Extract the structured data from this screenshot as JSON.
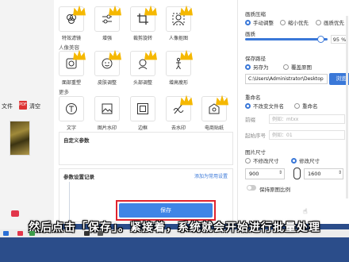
{
  "desktop": {
    "file_label": "文件",
    "clear_label": "清空",
    "pdf_text": "PDF"
  },
  "tools_row1": [
    {
      "label": "特效滤镜",
      "icon": "effects-icon"
    },
    {
      "label": "增强",
      "icon": "enhance-icon"
    },
    {
      "label": "裁剪旋转",
      "icon": "crop-icon"
    },
    {
      "label": "人像抠图",
      "icon": "portrait-cutout-icon"
    }
  ],
  "portrait_section": "人像美容",
  "tools_row2": [
    {
      "label": "面部重塑",
      "icon": "face-reshape-icon"
    },
    {
      "label": "皮肤调整",
      "icon": "skin-adjust-icon"
    },
    {
      "label": "头部调整",
      "icon": "head-adjust-icon"
    },
    {
      "label": "增高瘦形",
      "icon": "body-slim-icon"
    }
  ],
  "more_section": "更多",
  "tools_row3": [
    {
      "label": "文字",
      "icon": "text-icon"
    },
    {
      "label": "图片水印",
      "icon": "image-watermark-icon"
    },
    {
      "label": "边框",
      "icon": "border-icon"
    },
    {
      "label": "去水印",
      "icon": "remove-watermark-icon"
    },
    {
      "label": "电商贴纸",
      "icon": "sticker-icon"
    }
  ],
  "custom_params": {
    "title": "自定义参数"
  },
  "param_records": {
    "title": "参数设置记录",
    "link": "添加为常用设置"
  },
  "settings": {
    "compress_label": "画质压缩",
    "compress_options": [
      "手动调整",
      "缩小优先",
      "画质优先"
    ],
    "quality_label": "画质",
    "quality_value": "95",
    "quality_unit": "%",
    "save_path_label": "保存路径",
    "save_path_options": [
      "另存为",
      "覆盖原图"
    ],
    "path_value": "C:\\Users\\Administrator\\Desktop",
    "browse_label": "浏览",
    "rename_label": "重命名",
    "rename_options": [
      "不改变文件名",
      "重命名"
    ],
    "prefix_label": "前缀",
    "prefix_placeholder": "例如：mtxx",
    "start_label": "起始序号",
    "start_placeholder": "例如：01",
    "size_label": "图片尺寸",
    "size_options": [
      "不修改尺寸",
      "修改尺寸"
    ],
    "width_value": "900",
    "height_value": "1600",
    "keep_ratio_label": "保持原图比例",
    "save_label": "保存"
  },
  "colors": {
    "accent": "#3a78d8",
    "save_blue": "#3f85e6",
    "highlight_red": "#e0232e",
    "crown_gold": "#f5b800"
  },
  "caption": "然后点击「保存」。紧接着，系统就会开始进行批量处理"
}
